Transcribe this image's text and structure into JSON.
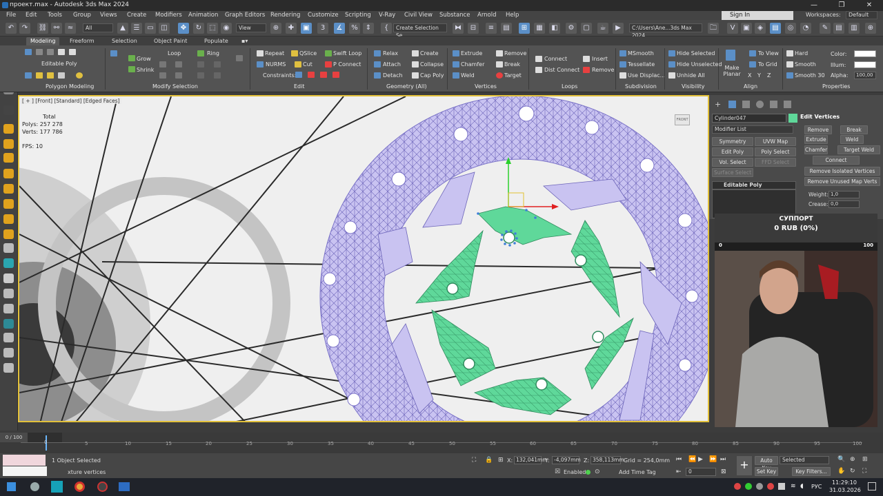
{
  "titlebar": {
    "title": "проект.max - Autodesk 3ds Max 2024",
    "minimize": "—",
    "maximize": "❐",
    "close": "✕"
  },
  "menu": [
    "File",
    "Edit",
    "Tools",
    "Group",
    "Views",
    "Create",
    "Modifiers",
    "Animation",
    "Graph Editors",
    "Rendering",
    "Customize",
    "Scripting",
    "V-Ray",
    "Civil View",
    "Substance",
    "Arnold",
    "Help"
  ],
  "signin": "Sign In",
  "workspaces": {
    "label": "Workspaces:",
    "value": "Default"
  },
  "toolbar": {
    "filter": "All",
    "refcoord": "View",
    "selset": "Create Selection Se",
    "path": "C:\\Users\\Ane...3ds Max 2024"
  },
  "ribbon_tabs": [
    "Modeling",
    "Freeform",
    "Selection",
    "Object Paint",
    "Populate"
  ],
  "ribbon": {
    "editable_poly": "Editable Poly",
    "grow": "Grow",
    "shrink": "Shrink",
    "loop": "Loop",
    "ring": "Ring",
    "repeat": "Repeat",
    "qslice": "QSlice",
    "swift_loop": "Swift Loop",
    "nurms": "NURMS",
    "cut": "Cut",
    "p_connect": "P Connect",
    "constraints": "Constraints:",
    "relax": "Relax",
    "create": "Create",
    "attach": "Attach",
    "collapse": "Collapse",
    "detach": "Detach",
    "cap_poly": "Cap Poly",
    "extrude": "Extrude",
    "remove": "Remove",
    "chamfer": "Chamfer",
    "break": "Break",
    "weld": "Weld",
    "target": "Target",
    "connect": "Connect",
    "dist_connect": "Dist Connect",
    "insert": "Insert",
    "remove2": "Remove",
    "msmooth": "MSmooth",
    "tessellate": "Tessellate",
    "use_displac": "Use Displac...",
    "hide_selected": "Hide Selected",
    "hide_unselected": "Hide Unselected",
    "unhide_all": "Unhide All",
    "make_planar": "Make Planar",
    "to_view": "To View",
    "to_grid": "To Grid",
    "hard": "Hard",
    "smooth": "Smooth",
    "smooth30": "Smooth 30",
    "color": "Color:",
    "illum": "Illum:",
    "alpha": "Alpha:",
    "alpha_val": "100,00",
    "groups": [
      "Polygon Modeling",
      "Modify Selection",
      "Edit",
      "Geometry (All)",
      "Vertices",
      "Loops",
      "Subdivision",
      "Visibility",
      "Align",
      "Properties"
    ]
  },
  "viewport": {
    "label": "[ + ] [Front] [Standard] [Edged Faces]",
    "total": "Total",
    "polys": "Polys:  257 278",
    "verts": "Verts:  177 786",
    "fps": "FPS:    10",
    "viewcube": "FRONT"
  },
  "command_panel": {
    "object_name": "Cylinder047",
    "modifier_list": "Modifier List",
    "buttons": [
      "Symmetry",
      "UVW Map",
      "Edit Poly",
      "Poly Select",
      "Vol. Select",
      "FFD Select",
      "Surface Select"
    ],
    "stack_item": "Editable Poly",
    "rollout": "Edit Vertices",
    "ev_buttons": [
      "Remove",
      "Break",
      "Extrude",
      "Weld",
      "Chamfer",
      "Target Weld",
      "Connect",
      "Remove Isolated Vertices",
      "Remove Unused Map Verts"
    ],
    "weight_label": "Weight:",
    "weight": "1,0",
    "crease_label": "Crease:",
    "crease": "0,0"
  },
  "support": {
    "title": "СУППОРТ",
    "amount": "0 RUB (0%)",
    "min": "0",
    "max": "100"
  },
  "timeline": {
    "frame": "0 / 100",
    "ticks": [
      "0",
      "5",
      "10",
      "15",
      "20",
      "25",
      "30",
      "35",
      "40",
      "45",
      "50",
      "55",
      "60",
      "65",
      "70",
      "75",
      "80",
      "85",
      "90",
      "95",
      "100"
    ]
  },
  "status": {
    "selected": "1 Object Selected",
    "prompt": "xture vertices",
    "x_label": "X:",
    "x": "132,041mm",
    "y_label": "Y:",
    "y": "-4,097mm",
    "z_label": "Z:",
    "z": "358,113mm",
    "grid": "Grid = 254,0mm",
    "enabled": "Enabled:",
    "add_time_tag": "Add Time Tag",
    "auto_key": "Auto Key",
    "set_key": "Set Key",
    "key_filters": "Key Filters...",
    "selected_dd": "Selected",
    "frame_field": "0"
  },
  "taskbar": {
    "time": "11:29:10",
    "date": "31.03.2026",
    "lang": "РУС"
  },
  "colors": {
    "accent": "#5b8fc7",
    "mesh": "#c9c3f1",
    "selected_poly": "#5fd89a",
    "viewport_border": "#e3c13a"
  }
}
